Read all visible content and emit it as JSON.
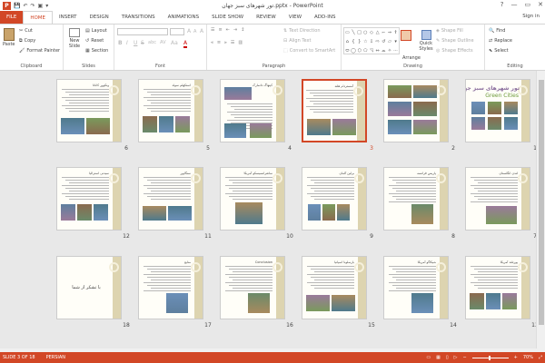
{
  "titlebar": {
    "title": "تور شهرهای سبز جهان.pptx - PowerPoint",
    "help": "?",
    "minimize": "—",
    "restore": "▭",
    "close": "✕"
  },
  "qat": {
    "save": "💾",
    "undo": "↶",
    "redo": "↷",
    "present": "▣",
    "more": "▾"
  },
  "tabs": [
    "FILE",
    "HOME",
    "INSERT",
    "DESIGN",
    "TRANSITIONS",
    "ANIMATIONS",
    "SLIDE SHOW",
    "REVIEW",
    "VIEW",
    "ADD-INS"
  ],
  "active_tab": "HOME",
  "signin": "Sign in",
  "ribbon": {
    "clipboard": {
      "paste": "Paste",
      "cut": "Cut",
      "copy": "Copy",
      "format_painter": "Format Painter",
      "label": "Clipboard"
    },
    "slides": {
      "new_slide": "New Slide",
      "layout": "Layout",
      "reset": "Reset",
      "section": "Section",
      "label": "Slides"
    },
    "font": {
      "bold": "B",
      "italic": "I",
      "underline": "U",
      "strike": "S",
      "shadow": "abc",
      "spacing": "AV",
      "case": "Aa",
      "color": "A",
      "grow": "A",
      "shrink": "A",
      "clear": "A",
      "label": "Font"
    },
    "paragraph": {
      "text_direction": "Text Direction",
      "align_text": "Align Text",
      "smartart": "Convert to SmartArt",
      "label": "Paragraph"
    },
    "drawing": {
      "arrange": "Arrange",
      "quick_styles": "Quick Styles",
      "shape_fill": "Shape Fill",
      "shape_outline": "Shape Outline",
      "shape_effects": "Shape Effects",
      "label": "Drawing",
      "shapes": [
        "▭",
        "╲",
        "□",
        "○",
        "◇",
        "△",
        "⌐",
        "⇒",
        "⇑",
        "⌂",
        "{",
        "}",
        "☆",
        "⇩",
        "⇨",
        "↺",
        "▱",
        "▾",
        "⬭",
        "◯",
        "⬡",
        "⬠",
        "◹",
        "⇔",
        "⌓",
        "✧",
        "⋯"
      ]
    },
    "editing": {
      "find": "Find",
      "replace": "Replace",
      "select": "Select",
      "label": "Editing"
    }
  },
  "slides": [
    {
      "num": "1",
      "title": "تور شهرهای سبز جهان",
      "subtitle": "Green Cities",
      "layout": "cover"
    },
    {
      "num": "2",
      "title": "",
      "layout": "photos"
    },
    {
      "num": "3",
      "title": "آمستردام هلند",
      "layout": "text-photos",
      "selected": true
    },
    {
      "num": "4",
      "title": "کپنهاگ دانمارک",
      "layout": "photo-top"
    },
    {
      "num": "5",
      "title": "استکهلم سوئد",
      "layout": "text-photos3"
    },
    {
      "num": "6",
      "title": "ونکوور کانادا",
      "layout": "text-photos"
    },
    {
      "num": "7",
      "title": "لندن انگلستان",
      "layout": "text-photo"
    },
    {
      "num": "8",
      "title": "پاریس فرانسه",
      "layout": "text-photo-small"
    },
    {
      "num": "9",
      "title": "برلین آلمان",
      "layout": "text-photos-small"
    },
    {
      "num": "10",
      "title": "سانفرانسیسکو آمریکا",
      "layout": "text-bridge"
    },
    {
      "num": "11",
      "title": "سنگاپور",
      "layout": "text-plane"
    },
    {
      "num": "12",
      "title": "سیدنی استرالیا",
      "layout": "text-photos3"
    },
    {
      "num": "13",
      "title": "پورتلند آمریکا",
      "layout": "text-photos3"
    },
    {
      "num": "14",
      "title": "شیکاگو آمریکا",
      "layout": "text-photo-small"
    },
    {
      "num": "15",
      "title": "بارسلونا اسپانیا",
      "layout": "text-photos"
    },
    {
      "num": "16",
      "title": "Conclusion",
      "layout": "text-photo-small"
    },
    {
      "num": "17",
      "title": "منابع",
      "layout": "text-photo-small"
    },
    {
      "num": "18",
      "title": "",
      "end_text": "با تشکر از شما",
      "layout": "end"
    }
  ],
  "statusbar": {
    "slide_info": "SLIDE 3 OF 18",
    "language": "PERSIAN",
    "zoom": "70%"
  },
  "colors": {
    "accent": "#d24726",
    "band": "#ddd4b0"
  }
}
